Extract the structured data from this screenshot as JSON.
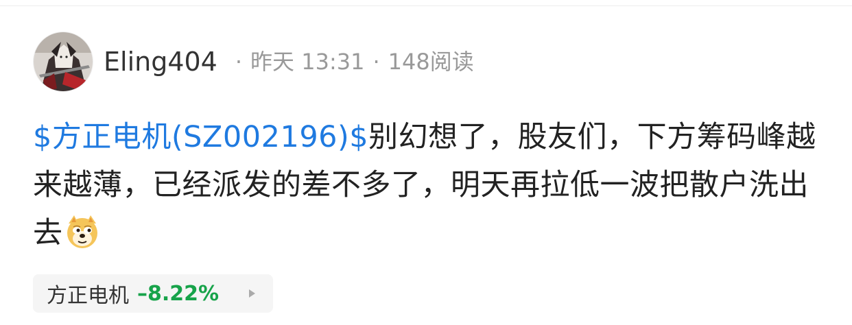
{
  "post": {
    "author": {
      "name": "Eling404",
      "avatar_icon": "user-avatar"
    },
    "meta": {
      "separator": "·",
      "date": "昨天 13:31",
      "reads": "148阅读"
    },
    "content": {
      "stock_link": "$方正电机(SZ002196)$",
      "text": "别幻想了，股友们，下方筹码峰越来越薄，已经派发的差不多了，明天再拉低一波把散户洗出去",
      "emoji": "doge-emoji-icon"
    },
    "stock_chip": {
      "name": "方正电机",
      "change": "–8.22%",
      "change_color": "#17a34a",
      "arrow_icon": "play-arrow-icon"
    }
  },
  "colors": {
    "link": "#1f7ae0",
    "text": "#222222",
    "meta": "#999999",
    "chip_bg": "#f5f5f5"
  }
}
